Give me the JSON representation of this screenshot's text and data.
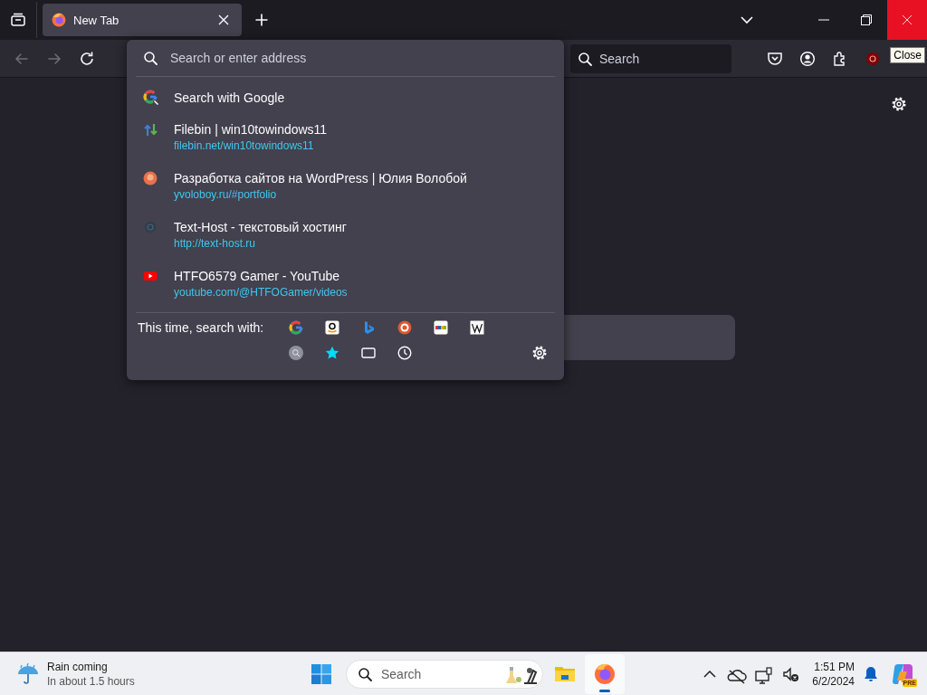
{
  "tab_strip": {
    "tabs": [
      {
        "title": "New Tab",
        "selected": true
      }
    ]
  },
  "window_controls": {
    "close": {
      "hovered": true,
      "tooltip": "Close"
    }
  },
  "toolbar": {
    "back": {
      "disabled": true
    },
    "forward": {
      "disabled": true
    },
    "search_field": {
      "placeholder": "Search"
    }
  },
  "address_popup": {
    "placeholder": "Search or enter address",
    "suggestions": [
      {
        "kind": "search",
        "title": "Search with Google"
      },
      {
        "kind": "arrows",
        "title": "Filebin | win10towindows11",
        "url": "filebin.net/win10towindows11"
      },
      {
        "kind": "avatar",
        "title": "Разработка сайтов на WordPress | Юлия Волобой",
        "url": "yvoloboy.ru/#portfolio"
      },
      {
        "kind": "globe",
        "title": "Text-Host - текстовый хостинг",
        "url": "http://text-host.ru"
      },
      {
        "kind": "video",
        "title": "HTFO6579 Gamer - YouTube",
        "url": "youtube.com/@HTFOGamer/videos"
      }
    ],
    "one_offs_label": "This time, search with:"
  },
  "taskbar": {
    "weather": {
      "title": "Rain coming",
      "detail": "In about 1.5 hours"
    },
    "search": {
      "placeholder": "Search"
    },
    "apps": [
      {
        "kind": "explorer",
        "active": false
      },
      {
        "kind": "firefox",
        "active": true
      }
    ],
    "clock": {
      "time": "1:51 PM",
      "date": "6/2/2024"
    },
    "copilot_badge": "PRE"
  }
}
